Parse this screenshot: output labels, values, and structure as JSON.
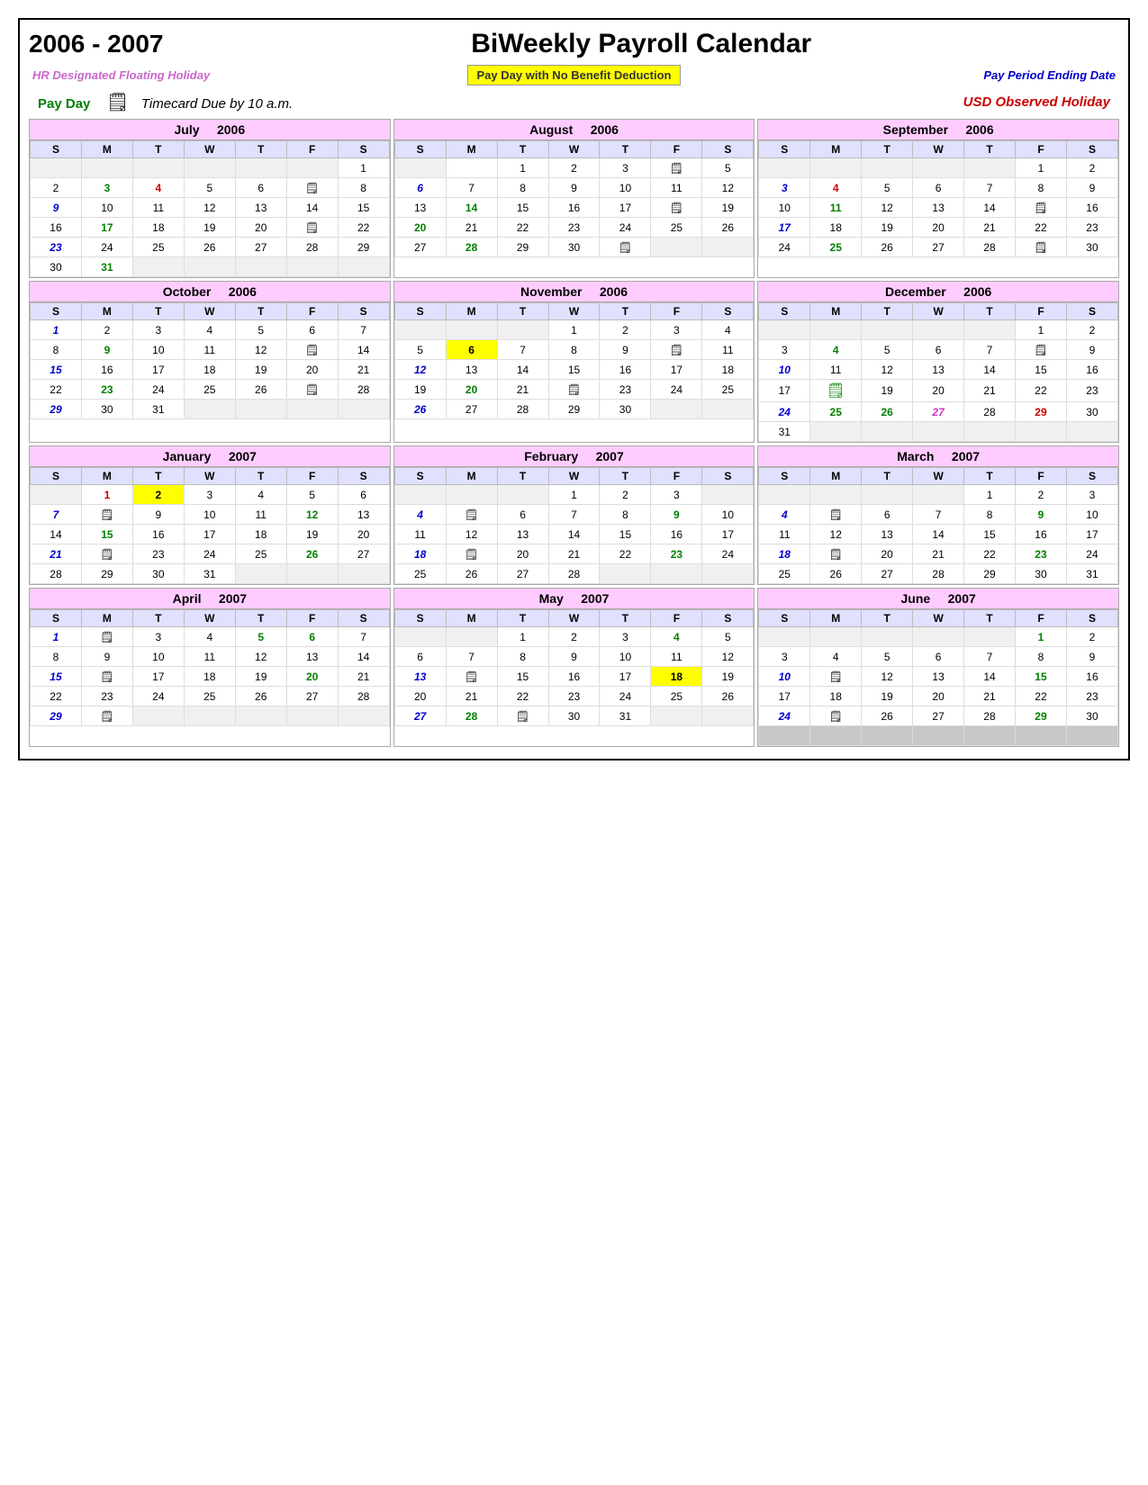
{
  "header": {
    "year": "2006 - 2007",
    "title": "BiWeekly Payroll Calendar"
  },
  "legend": {
    "floating": "HR Designated Floating Holiday",
    "payday_no_benefit": "Pay Day with No Benefit Deduction",
    "period_ending": "Pay Period Ending Date"
  },
  "sub_legend": {
    "payday_label": "Pay Day",
    "timecard_label": "Timecard Due by 10 a.m.",
    "usd_holiday": "USD Observed Holiday"
  }
}
